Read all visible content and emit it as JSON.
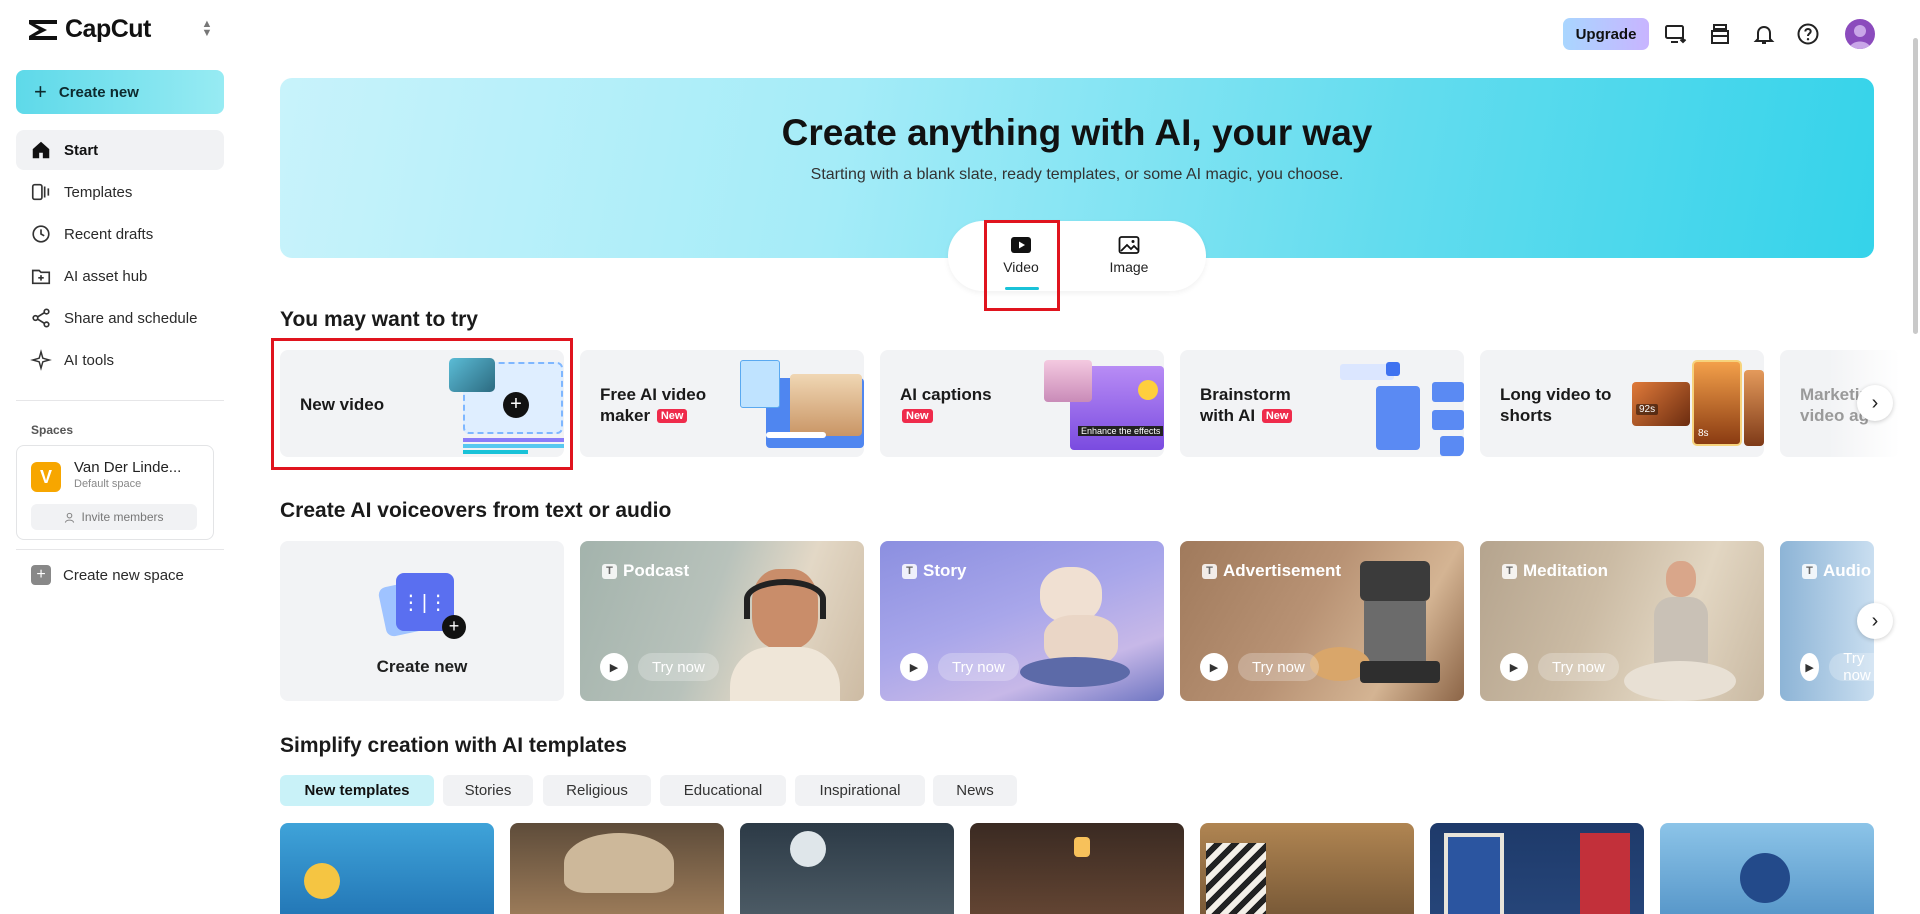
{
  "sidebar": {
    "brand": "CapCut",
    "create_label": "Create new",
    "nav": [
      {
        "label": "Start"
      },
      {
        "label": "Templates"
      },
      {
        "label": "Recent drafts"
      },
      {
        "label": "AI asset hub"
      },
      {
        "label": "Share and schedule"
      },
      {
        "label": "AI tools"
      }
    ],
    "spaces_title": "Spaces",
    "space": {
      "initial": "V",
      "name": "Van Der Linde...",
      "sub": "Default space",
      "invite": "Invite members"
    },
    "new_space": "Create new space"
  },
  "topbar": {
    "upgrade": "Upgrade"
  },
  "hero": {
    "title": "Create anything with AI, your way",
    "subtitle": "Starting with a blank slate, ready templates, or some AI magic, you choose.",
    "tabs": [
      {
        "label": "Video"
      },
      {
        "label": "Image"
      }
    ]
  },
  "try_section": {
    "title": "You may want to try",
    "cards": [
      {
        "label": "New video",
        "new": ""
      },
      {
        "label": "Free AI video maker",
        "new": "New"
      },
      {
        "label": "AI captions",
        "new": "New"
      },
      {
        "label": "Brainstorm with AI",
        "new": "New"
      },
      {
        "label": "Long video to shorts",
        "new": ""
      },
      {
        "label": "Marketing video ag",
        "new": ""
      }
    ],
    "captions_overlay": "Enhance the effects",
    "shorts_badges": [
      "92s",
      "8s"
    ]
  },
  "voice_section": {
    "title": "Create AI voiceovers from text or audio",
    "create_label": "Create new",
    "try_label": "Try now",
    "cards": [
      {
        "label": "Podcast"
      },
      {
        "label": "Story"
      },
      {
        "label": "Advertisement"
      },
      {
        "label": "Meditation"
      },
      {
        "label": "Audio"
      }
    ]
  },
  "templates_section": {
    "title": "Simplify creation with AI templates",
    "chips": [
      "New templates",
      "Stories",
      "Religious",
      "Educational",
      "Inspirational",
      "News"
    ]
  },
  "colors": {
    "accent": "#19c2d8",
    "highlight": "#e0141e",
    "new_badge": "#ef2b4b"
  }
}
